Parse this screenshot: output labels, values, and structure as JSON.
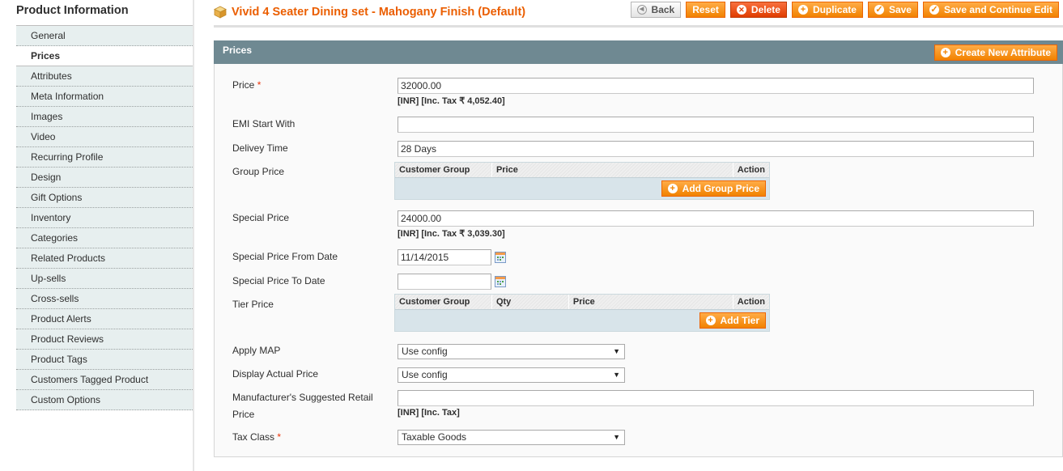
{
  "sidebar": {
    "title": "Product Information",
    "tabs": [
      {
        "label": "General",
        "active": false
      },
      {
        "label": "Prices",
        "active": true
      },
      {
        "label": "Attributes",
        "active": false
      },
      {
        "label": "Meta Information",
        "active": false
      },
      {
        "label": "Images",
        "active": false
      },
      {
        "label": "Video",
        "active": false
      },
      {
        "label": "Recurring Profile",
        "active": false
      },
      {
        "label": "Design",
        "active": false
      },
      {
        "label": "Gift Options",
        "active": false
      },
      {
        "label": "Inventory",
        "active": false
      },
      {
        "label": "Categories",
        "active": false
      },
      {
        "label": "Related Products",
        "active": false
      },
      {
        "label": "Up-sells",
        "active": false
      },
      {
        "label": "Cross-sells",
        "active": false
      },
      {
        "label": "Product Alerts",
        "active": false
      },
      {
        "label": "Product Reviews",
        "active": false
      },
      {
        "label": "Product Tags",
        "active": false
      },
      {
        "label": "Customers Tagged Product",
        "active": false
      },
      {
        "label": "Custom Options",
        "active": false
      }
    ]
  },
  "header": {
    "title": "Vivid 4 Seater Dining set - Mahogany Finish (Default)",
    "title_icon": "product-box-icon",
    "buttons": {
      "back": "Back",
      "reset": "Reset",
      "delete": "Delete",
      "duplicate": "Duplicate",
      "save": "Save",
      "save_continue": "Save and Continue Edit"
    }
  },
  "section": {
    "title": "Prices",
    "create_attribute": "Create New Attribute"
  },
  "form": {
    "price": {
      "label": "Price",
      "required_mark": "*",
      "value": "32000.00",
      "note": "[INR] [Inc. Tax ₹ 4,052.40]"
    },
    "emi": {
      "label": "EMI Start With",
      "value": ""
    },
    "delivery": {
      "label": "Delivey Time",
      "value": "28 Days"
    },
    "group_price": {
      "label": "Group Price",
      "columns": [
        "Customer Group",
        "Price",
        "Action"
      ],
      "add_button": "Add Group Price"
    },
    "special_price": {
      "label": "Special Price",
      "value": "24000.00",
      "note": "[INR] [Inc. Tax ₹ 3,039.30]"
    },
    "special_from": {
      "label": "Special Price From Date",
      "value": "11/14/2015"
    },
    "special_to": {
      "label": "Special Price To Date",
      "value": ""
    },
    "tier_price": {
      "label": "Tier Price",
      "columns": [
        "Customer Group",
        "Qty",
        "Price",
        "Action"
      ],
      "add_button": "Add Tier"
    },
    "apply_map": {
      "label": "Apply MAP",
      "value": "Use config"
    },
    "display_actual": {
      "label": "Display Actual Price",
      "value": "Use config"
    },
    "msrp": {
      "label_line1": "Manufacturer's Suggested Retail",
      "label_line2": "Price",
      "value": "",
      "note": "[INR] [Inc. Tax]"
    },
    "tax_class": {
      "label": "Tax Class",
      "required_mark": "*",
      "value": "Taxable Goods"
    }
  },
  "colors": {
    "accent": "#eb5e00",
    "button_orange": "#f18200",
    "delete_red": "#e03d00",
    "section_header": "#6f8992",
    "tab_bg": "#e7efef"
  }
}
